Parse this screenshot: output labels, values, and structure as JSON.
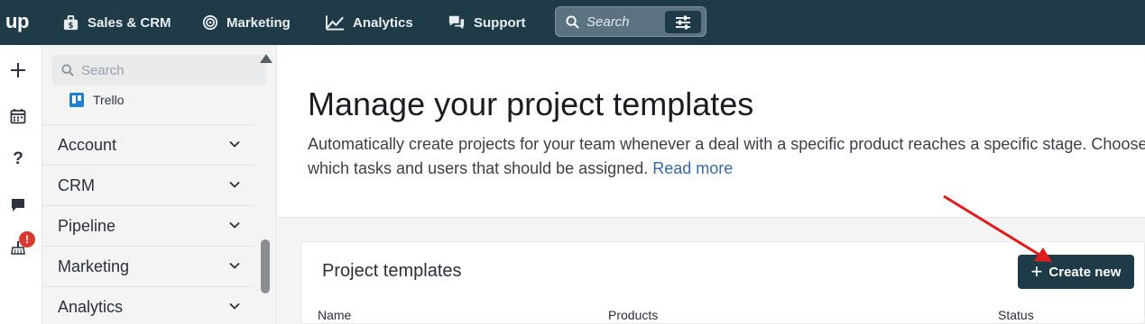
{
  "topbar": {
    "logo": "up",
    "nav": [
      {
        "label": "Sales & CRM",
        "icon": "briefcase-dollar-icon"
      },
      {
        "label": "Marketing",
        "icon": "target-icon"
      },
      {
        "label": "Analytics",
        "icon": "line-chart-icon"
      },
      {
        "label": "Support",
        "icon": "chat-bubbles-icon"
      }
    ],
    "search": {
      "placeholder": "Search",
      "filter_icon": "sliders-icon"
    }
  },
  "rail": {
    "icons": [
      "plus-icon",
      "calendar-icon",
      "question-icon",
      "chat-icon",
      "broom-icon"
    ],
    "alert_badge": "!"
  },
  "sidebar": {
    "search_placeholder": "Search",
    "partial_item": "Trello",
    "items": [
      {
        "label": "Account"
      },
      {
        "label": "CRM"
      },
      {
        "label": "Pipeline"
      },
      {
        "label": "Marketing"
      },
      {
        "label": "Analytics"
      }
    ]
  },
  "main": {
    "title": "Manage your project templates",
    "description": "Automatically create projects for your team whenever a deal with a specific product reaches a specific stage. Choose which tasks and users that should be assigned.",
    "description_line1": "Automatically create projects for your team whenever a deal with a specific product reaches a specific stage. Choose",
    "description_line2": "which tasks and users that should be assigned. ",
    "read_more": "Read more",
    "templates_card": {
      "title": "Project templates",
      "create_button": "Create new",
      "columns": [
        "Name",
        "Products",
        "Status"
      ]
    }
  },
  "colors": {
    "topbar": "#1f3b47",
    "accent_link": "#3868a8",
    "badge": "#d93a2e",
    "annotation_arrow": "#e01b1b"
  }
}
